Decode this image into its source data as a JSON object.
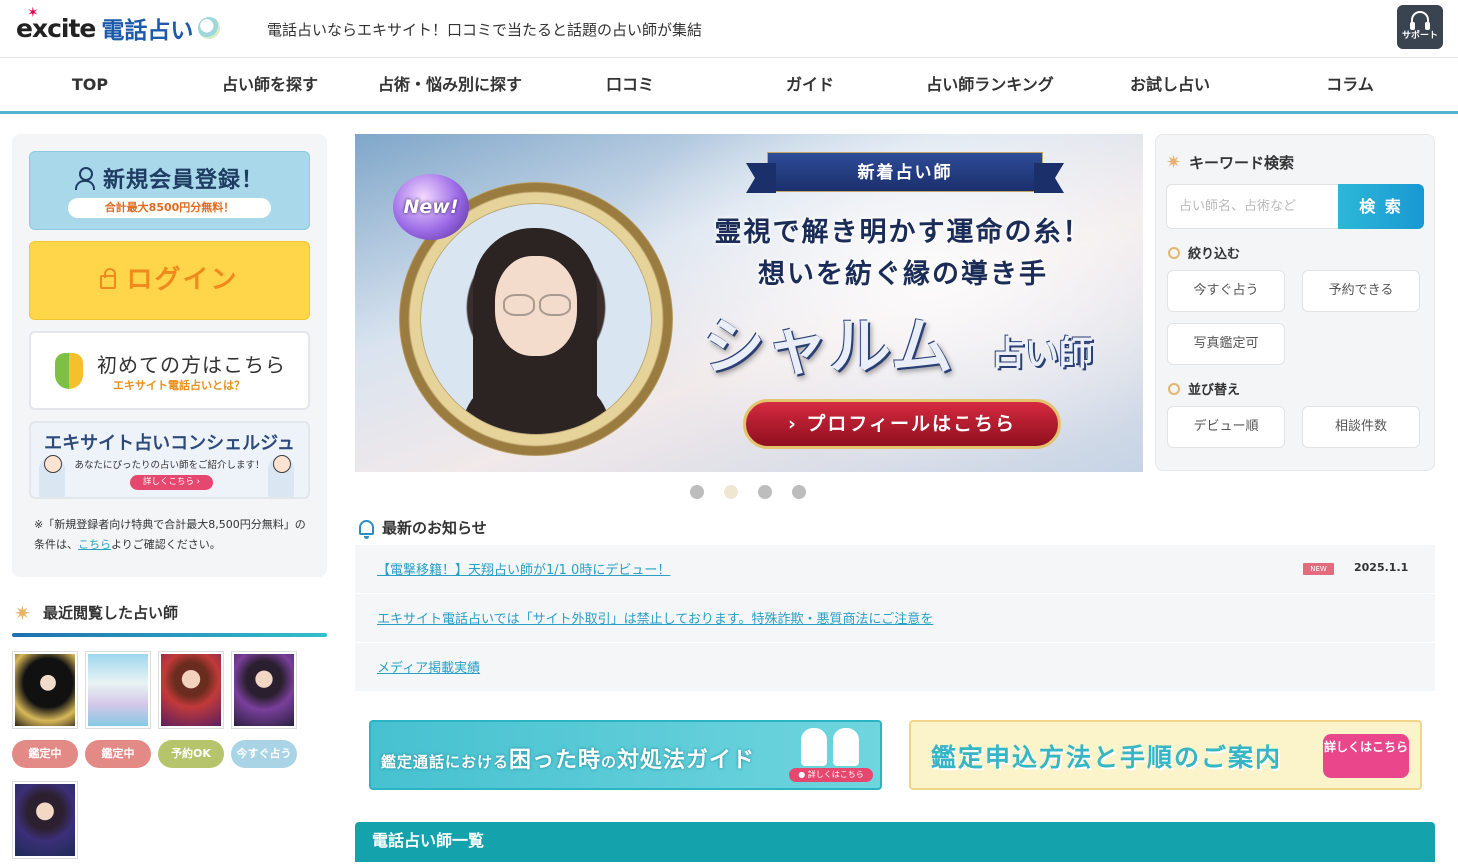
{
  "header": {
    "logo_excite": "excite",
    "logo_service": "電話占い",
    "tagline": "電話占いならエキサイト！口コミで当たると話題の占い師が集結",
    "support_label": "サポート"
  },
  "nav": [
    "TOP",
    "占い師を探す",
    "占術・悩み別に探す",
    "口コミ",
    "ガイド",
    "占い師ランキング",
    "お試し占い",
    "コラム"
  ],
  "left": {
    "register_title": "新規会員登録！",
    "register_sub": "合計最大8500円分無料！",
    "login": "ログイン",
    "first_title": "初めての方はこちら",
    "first_sub": "エキサイト電話占いとは？",
    "concierge_title": "エキサイト占いコンシェルジュ",
    "concierge_sub": "あなたにぴったりの占い師をご紹介します！",
    "concierge_btn": "詳しくこちら ›",
    "note_pre": "※「新規登録者向け特典で合計最大8,500円分無料」の条件は、",
    "note_link": "こちら",
    "note_post": "よりご確認ください。"
  },
  "recent": {
    "title": "最近閲覧した占い師",
    "badges": [
      {
        "label": "鑑定中",
        "color": "#e48a86"
      },
      {
        "label": "鑑定中",
        "color": "#e48a86"
      },
      {
        "label": "予約OK",
        "color": "#b6c46b"
      },
      {
        "label": "今すぐ占う",
        "color": "#a9d4e6"
      }
    ]
  },
  "hero": {
    "new_badge": "New!",
    "ribbon": "新着占い師",
    "line1": "霊視で解き明かす運命の糸！",
    "line2": "想いを紡ぐ縁の導き手",
    "name": "シャルム",
    "role": "占い師",
    "profile_btn": "› プロフィールはこちら",
    "slides": 4,
    "active_slide": 2
  },
  "news": {
    "title": "最新のお知らせ",
    "items": [
      {
        "text": "【電撃移籍！】天翔占い師が1/1 0時にデビュー！",
        "badge": "NEW",
        "date": "2025.1.1"
      },
      {
        "text": "エキサイト電話占いでは「サイト外取引」は禁止しております。特殊詐欺・悪質商法にご注意を",
        "badge": "",
        "date": ""
      },
      {
        "text": "メディア掲載実績",
        "badge": "",
        "date": ""
      }
    ]
  },
  "banners": {
    "guide_pre": "鑑定通話における",
    "guide_main": "困った時",
    "guide_mid": "の",
    "guide_end": "対処法ガイド",
    "guide_btn": "● 詳しくはこちら",
    "apply": "鑑定申込方法と手順のご案内",
    "apply_btn": "詳しくはこちら"
  },
  "list_title": "電話占い師一覧",
  "search": {
    "title": "キーワード検索",
    "placeholder": "占い師名、占術など",
    "button": "検 索",
    "filter_title": "絞り込む",
    "filters": [
      "今すぐ占う",
      "予約できる",
      "写真鑑定可"
    ],
    "sort_title": "並び替え",
    "sorts": [
      "デビュー順",
      "相談件数"
    ]
  }
}
